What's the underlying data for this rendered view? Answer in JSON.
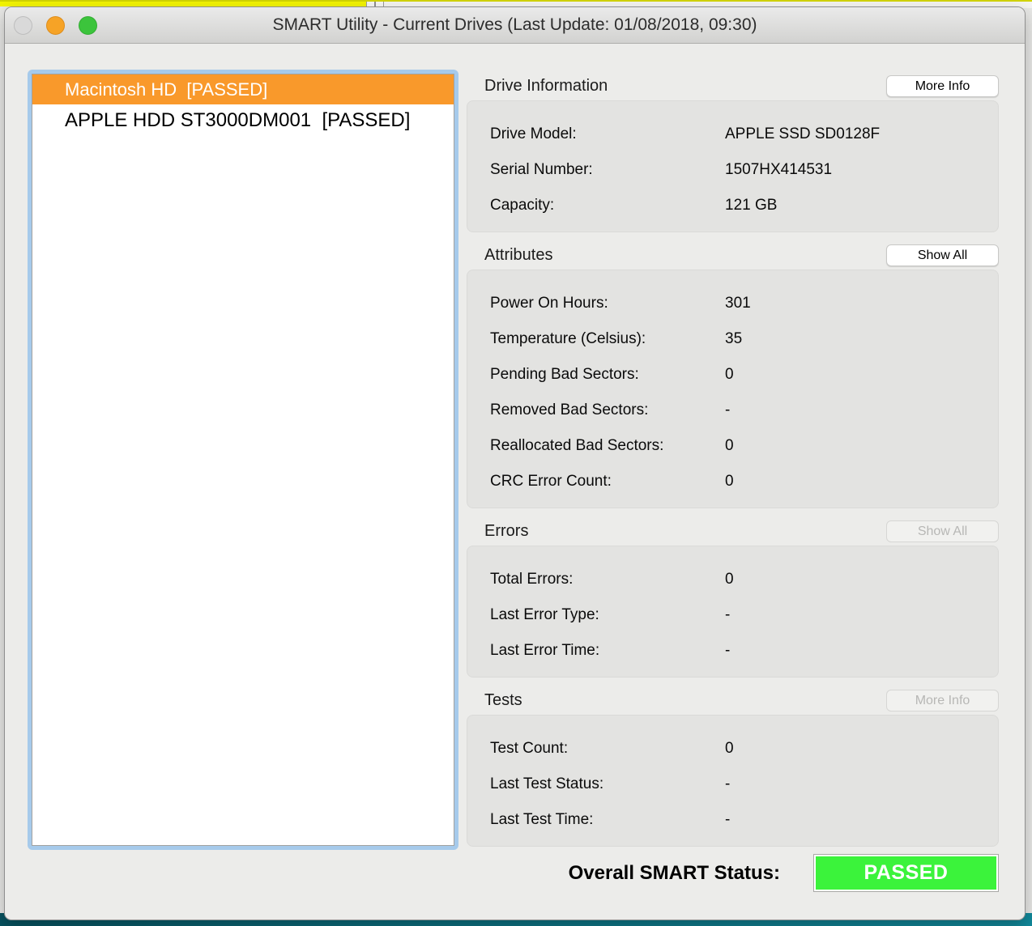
{
  "window": {
    "title": "SMART Utility - Current Drives (Last Update: 01/08/2018, 09:30)"
  },
  "colors": {
    "selected_row": "#f9992b",
    "focus_ring": "#a6caeb",
    "status_green": "#3bf33b",
    "minimize_orange": "#f6a326",
    "top_strip_yellow": "#f3f402",
    "bottom_strip_teal": "#0b6a79"
  },
  "drive_list": {
    "items": [
      {
        "label": "Macintosh HD  [PASSED]",
        "selected": true
      },
      {
        "label": "APPLE HDD ST3000DM001  [PASSED]",
        "selected": false
      }
    ]
  },
  "sections": [
    {
      "id": "drive-information",
      "title": "Drive Information",
      "button": {
        "label": "More Info",
        "enabled": true
      },
      "rows": [
        {
          "label": "Drive Model:",
          "value": "APPLE SSD SD0128F"
        },
        {
          "label": "Serial Number:",
          "value": "1507HX414531"
        },
        {
          "label": "Capacity:",
          "value": "121 GB"
        }
      ]
    },
    {
      "id": "attributes",
      "title": "Attributes",
      "button": {
        "label": "Show All",
        "enabled": true
      },
      "rows": [
        {
          "label": "Power On Hours:",
          "value": "301"
        },
        {
          "label": "Temperature (Celsius):",
          "value": "35"
        },
        {
          "label": "Pending Bad Sectors:",
          "value": "0"
        },
        {
          "label": "Removed Bad Sectors:",
          "value": "-"
        },
        {
          "label": "Reallocated Bad Sectors:",
          "value": "0"
        },
        {
          "label": "CRC Error Count:",
          "value": "0"
        }
      ]
    },
    {
      "id": "errors",
      "title": "Errors",
      "button": {
        "label": "Show All",
        "enabled": false
      },
      "rows": [
        {
          "label": "Total Errors:",
          "value": "0"
        },
        {
          "label": "Last Error Type:",
          "value": "-"
        },
        {
          "label": "Last Error Time:",
          "value": "-"
        }
      ]
    },
    {
      "id": "tests",
      "title": "Tests",
      "button": {
        "label": "More Info",
        "enabled": false
      },
      "rows": [
        {
          "label": "Test Count:",
          "value": "0"
        },
        {
          "label": "Last Test Status:",
          "value": "-"
        },
        {
          "label": "Last Test Time:",
          "value": "-"
        }
      ]
    }
  ],
  "footer": {
    "status_label": "Overall SMART Status:",
    "status_value": "PASSED"
  }
}
